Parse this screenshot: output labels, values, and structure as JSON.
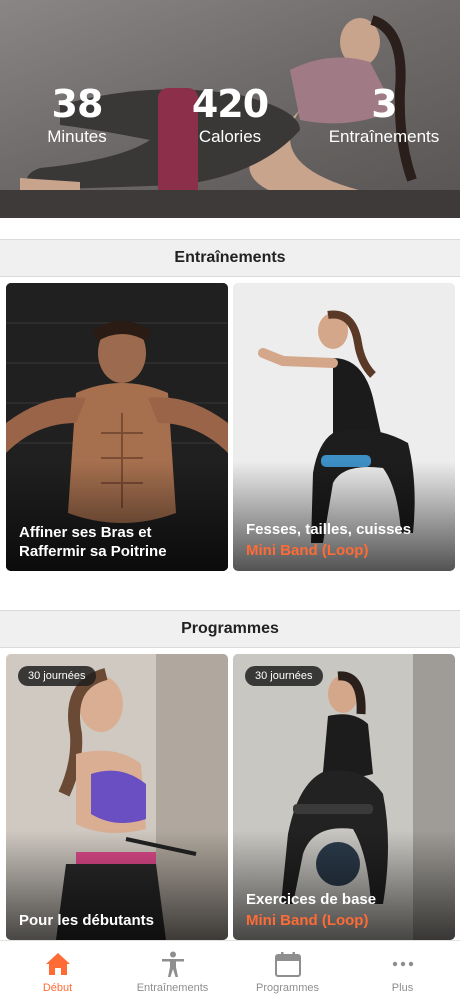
{
  "hero": {
    "stats": [
      {
        "value": "38",
        "label": "Minutes"
      },
      {
        "value": "420",
        "label": "Calories"
      },
      {
        "value": "3",
        "label": "Entraînements"
      }
    ]
  },
  "sections": {
    "workouts_title": "Entraînements",
    "programs_title": "Programmes"
  },
  "workouts": [
    {
      "title": "Affiner ses Bras et Raffermir sa Poitrine",
      "subtitle": ""
    },
    {
      "title": "Fesses, tailles, cuisses",
      "subtitle": "Mini Band (Loop)"
    }
  ],
  "programs": [
    {
      "badge": "30 journées",
      "title": "Pour les débutants",
      "subtitle": ""
    },
    {
      "badge": "30 journées",
      "title": "Exercices de base",
      "subtitle": "Mini Band (Loop)"
    }
  ],
  "tabs": [
    {
      "label": "Début",
      "icon": "home-icon",
      "active": true
    },
    {
      "label": "Entraînements",
      "icon": "person-icon",
      "active": false
    },
    {
      "label": "Programmes",
      "icon": "calendar-icon",
      "active": false
    },
    {
      "label": "Plus",
      "icon": "more-dots-icon",
      "active": false
    }
  ],
  "colors": {
    "accent": "#ff6b35",
    "inactive_tab": "#8e8e8e"
  }
}
